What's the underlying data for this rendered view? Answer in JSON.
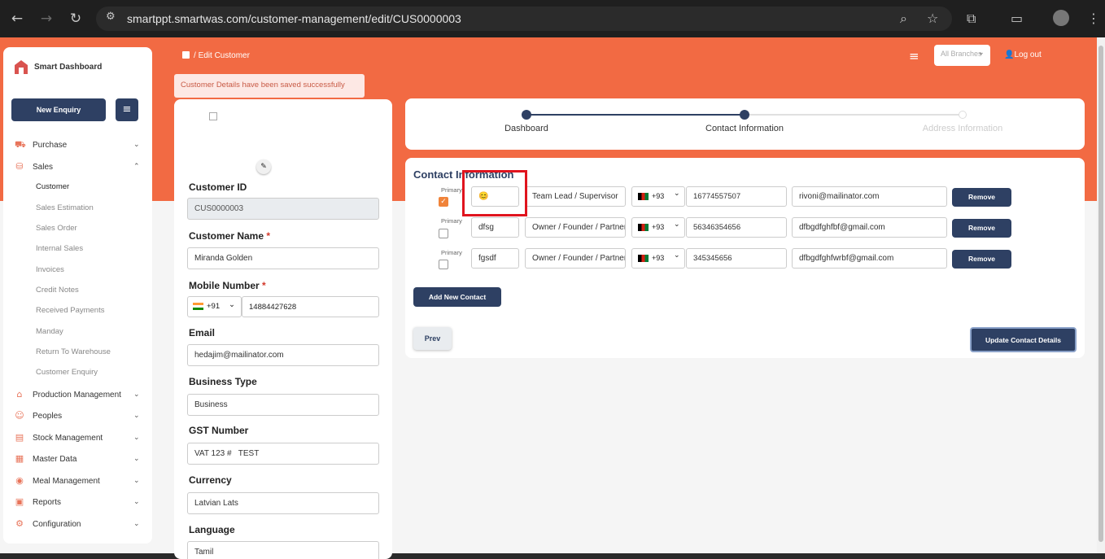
{
  "browser": {
    "url": "smartppt.smartwas.com/customer-management/edit/CUS0000003",
    "back_icon": "back-arrow-icon",
    "forward_icon": "forward-arrow-icon",
    "reload_icon": "reload-icon"
  },
  "colors": {
    "accent": "#f26a43",
    "primary": "#2e4063",
    "highlight": "#e0141e"
  },
  "sidebar": {
    "app_name": "Smart Dashboard",
    "new_enquiry": "New Enquiry",
    "items": [
      {
        "label": "Purchase",
        "expanded": false
      },
      {
        "label": "Sales",
        "expanded": true
      },
      {
        "label": "Production Management",
        "expanded": false
      },
      {
        "label": "Peoples",
        "expanded": false
      },
      {
        "label": "Stock Management",
        "expanded": false
      },
      {
        "label": "Master Data",
        "expanded": false
      },
      {
        "label": "Meal Management",
        "expanded": false
      },
      {
        "label": "Reports",
        "expanded": false
      },
      {
        "label": "Configuration",
        "expanded": false
      }
    ],
    "sales_sub": [
      "Customer",
      "Sales Estimation",
      "Sales Order",
      "Internal Sales",
      "Invoices",
      "Credit Notes",
      "Received Payments",
      "Manday",
      "Return To Warehouse",
      "Customer Enquiry"
    ]
  },
  "header": {
    "breadcrumb_sep": "/",
    "breadcrumb": "Edit Customer",
    "branch": "All Branches",
    "logout": "Log out"
  },
  "toast": "Customer Details have been saved successfully",
  "customer": {
    "id_label": "Customer ID",
    "id_value": "CUS0000003",
    "name_label": "Customer Name",
    "name_value": "Miranda Golden",
    "mobile_label": "Mobile Number",
    "mobile_code": "+91",
    "mobile_value": "14884427628",
    "email_label": "Email",
    "email_value": "hedajim@mailinator.com",
    "business_label": "Business Type",
    "business_value": "Business",
    "gst_label": "GST Number",
    "gst_value": "VAT 123 #   TEST",
    "currency_label": "Currency",
    "currency_value": "Latvian Lats",
    "language_label": "Language",
    "language_value": "Tamil"
  },
  "steps": [
    "Dashboard",
    "Contact Information",
    "Address Information"
  ],
  "contacts": {
    "title": "Contact Information",
    "primary_label": "Primary",
    "rows": [
      {
        "primary": true,
        "name": "😊",
        "role": "Team Lead / Supervisor",
        "code": "+93",
        "phone": "16774557507",
        "email": "rivoni@mailinator.com"
      },
      {
        "primary": false,
        "name": "dfsg",
        "role": "Owner / Founder / Partner",
        "code": "+93",
        "phone": "56346354656",
        "email": "dfbgdfghfbf@gmail.com"
      },
      {
        "primary": false,
        "name": "fgsdf",
        "role": "Owner / Founder / Partner",
        "code": "+93",
        "phone": "345345656",
        "email": "dfbgdfghfwrbf@gmail.com"
      }
    ],
    "remove": "Remove",
    "add": "Add New Contact",
    "prev": "Prev",
    "update": "Update Contact Details"
  }
}
